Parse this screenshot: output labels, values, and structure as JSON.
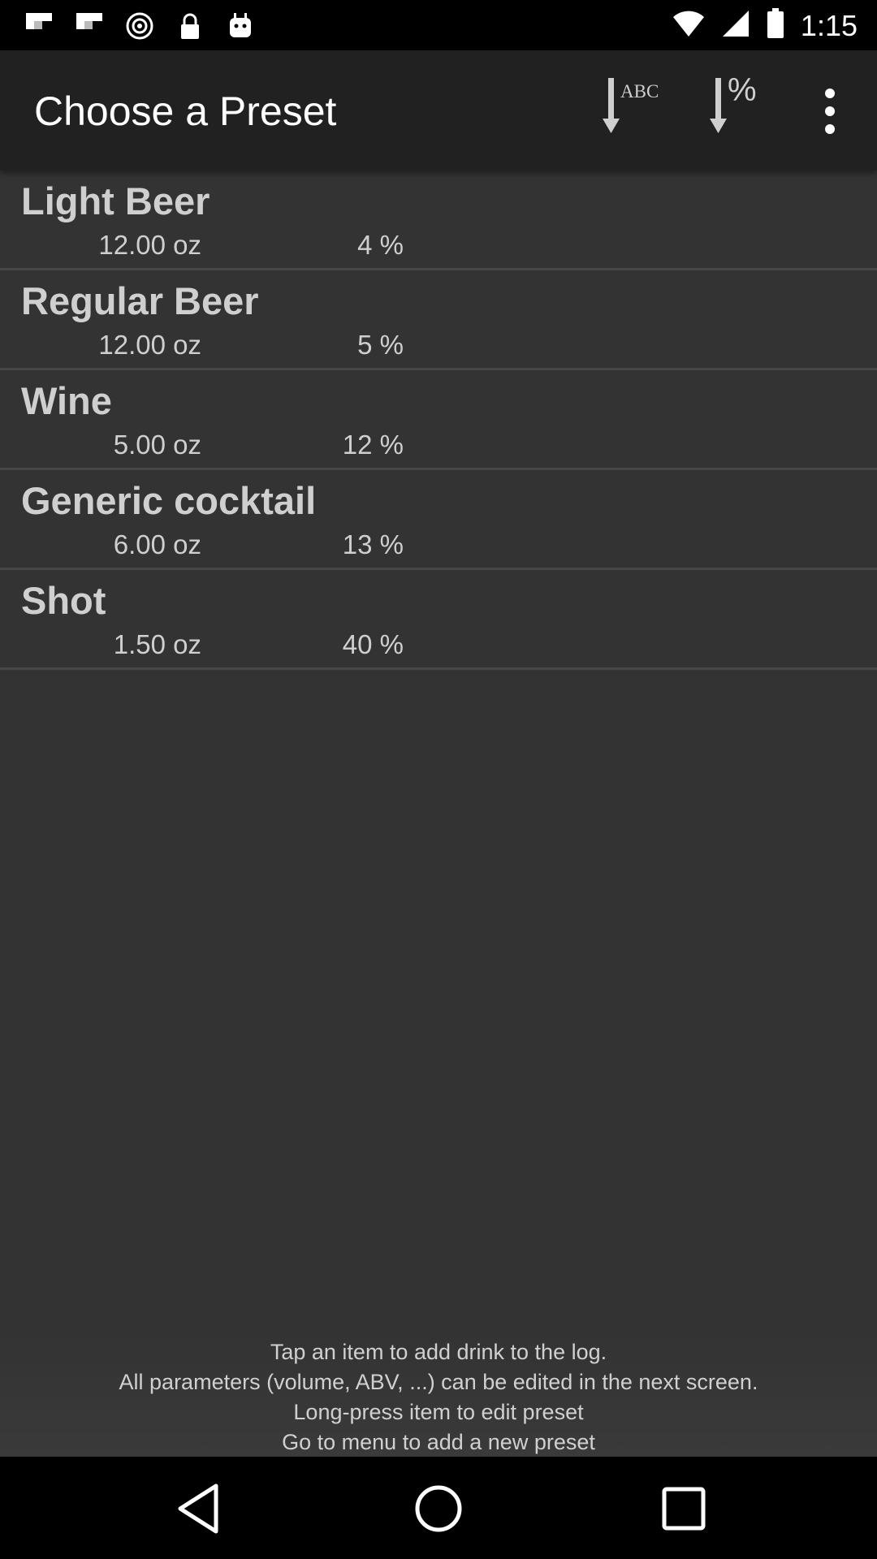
{
  "status_bar": {
    "time": "1:15",
    "left_icons": [
      "flipboard-icon",
      "flipboard-icon",
      "cast-icon",
      "lock-icon",
      "android-icon"
    ],
    "right_icons": [
      "wifi-icon",
      "signal-icon",
      "battery-icon"
    ]
  },
  "toolbar": {
    "title": "Choose a Preset",
    "sort_abc_label": "ABC",
    "sort_pct_label": "%",
    "overflow_icon": "more-vert-icon"
  },
  "presets": [
    {
      "name": "Light Beer",
      "volume": "12.00 oz",
      "abv": "4 %"
    },
    {
      "name": "Regular Beer",
      "volume": "12.00 oz",
      "abv": "5 %"
    },
    {
      "name": "Wine",
      "volume": "5.00 oz",
      "abv": "12 %"
    },
    {
      "name": "Generic cocktail",
      "volume": "6.00 oz",
      "abv": "13 %"
    },
    {
      "name": "Shot",
      "volume": "1.50 oz",
      "abv": "40 %"
    }
  ],
  "help": {
    "lines": [
      "Tap an item to add drink to the log.",
      "All parameters (volume, ABV, ...) can be edited in the next screen.",
      "Long-press item to edit preset",
      "Go to menu to add a new preset"
    ]
  },
  "nav_bar": {
    "icons": [
      "back-icon",
      "home-icon",
      "recents-icon"
    ]
  },
  "colors": {
    "background": "#333333",
    "toolbar": "#212121",
    "text_primary": "#ffffff",
    "text_list": "#cfcfcf",
    "divider": "#474747"
  }
}
